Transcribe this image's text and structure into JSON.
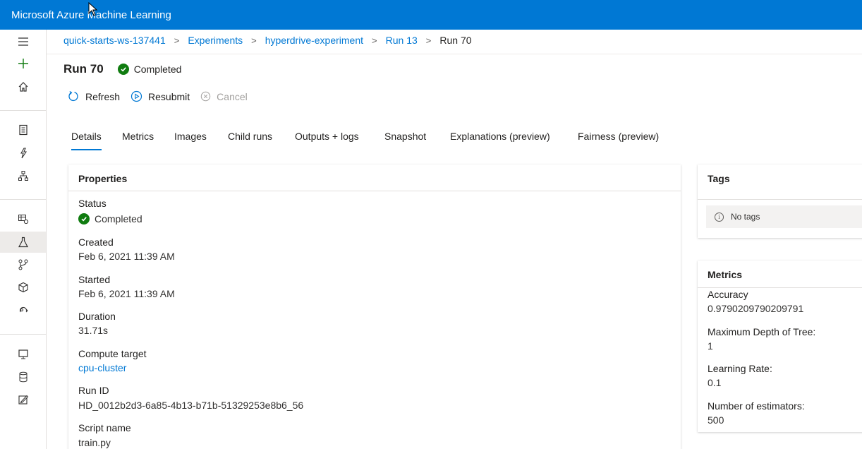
{
  "app": {
    "title": "Microsoft Azure Machine Learning"
  },
  "breadcrumb": {
    "workspace": "quick-starts-ws-137441",
    "experiments": "Experiments",
    "experiment": "hyperdrive-experiment",
    "parent_run": "Run 13",
    "current": "Run 70"
  },
  "run": {
    "title": "Run 70",
    "status": "Completed"
  },
  "toolbar": {
    "refresh": "Refresh",
    "resubmit": "Resubmit",
    "cancel": "Cancel"
  },
  "tabs": [
    "Details",
    "Metrics",
    "Images",
    "Child runs",
    "Outputs + logs",
    "Snapshot",
    "Explanations (preview)",
    "Fairness (preview)"
  ],
  "properties": {
    "title": "Properties",
    "status_label": "Status",
    "status_value": "Completed",
    "created_label": "Created",
    "created_value": "Feb 6, 2021 11:39 AM",
    "started_label": "Started",
    "started_value": "Feb 6, 2021 11:39 AM",
    "duration_label": "Duration",
    "duration_value": "31.71s",
    "compute_label": "Compute target",
    "compute_value": "cpu-cluster",
    "runid_label": "Run ID",
    "runid_value": "HD_0012b2d3-6a85-4b13-b71b-51329253e8b6_56",
    "script_label": "Script name",
    "script_value": "train.py"
  },
  "tags": {
    "title": "Tags",
    "empty": "No tags"
  },
  "metrics": {
    "title": "Metrics",
    "items": [
      {
        "label": "Accuracy",
        "value": "0.9790209790209791"
      },
      {
        "label": "Maximum Depth of Tree:",
        "value": "1"
      },
      {
        "label": "Learning Rate:",
        "value": "0.1"
      },
      {
        "label": "Number of estimators:",
        "value": "500"
      }
    ]
  },
  "colors": {
    "brand": "#0078d4",
    "success": "#107c10",
    "link": "#0078d4"
  },
  "icons": {
    "nav": [
      "hamburger-icon",
      "plus-icon",
      "home-icon",
      "notebook-icon",
      "automl-icon",
      "designer-icon",
      "datasets-icon",
      "experiments-icon",
      "pipelines-icon",
      "models-icon",
      "endpoints-icon",
      "compute-icon",
      "datastores-icon",
      "labeling-icon"
    ]
  }
}
